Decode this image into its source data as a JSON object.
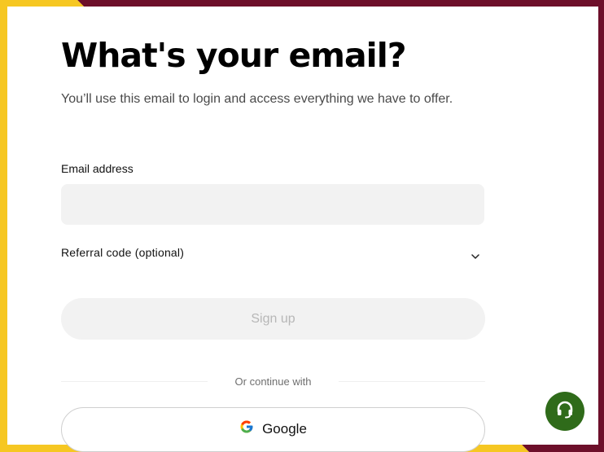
{
  "page": {
    "title": "What's your email?",
    "subtitle": "You’ll use this email to login and access everything we have to offer."
  },
  "form": {
    "email_label": "Email address",
    "email_value": "",
    "email_placeholder": "",
    "referral_label": "Referral code (optional)",
    "signup_label": "Sign up",
    "divider_text": "Or continue with",
    "google_label": "Google"
  },
  "icons": {
    "referral_toggle": "chevron-down-icon",
    "google": "google-icon",
    "support": "headset-icon"
  },
  "colors": {
    "frame_yellow": "#f6c722",
    "frame_maroon": "#6d0f2a",
    "input_bg": "#f2f2f2",
    "support_green": "#2f6b1a"
  }
}
